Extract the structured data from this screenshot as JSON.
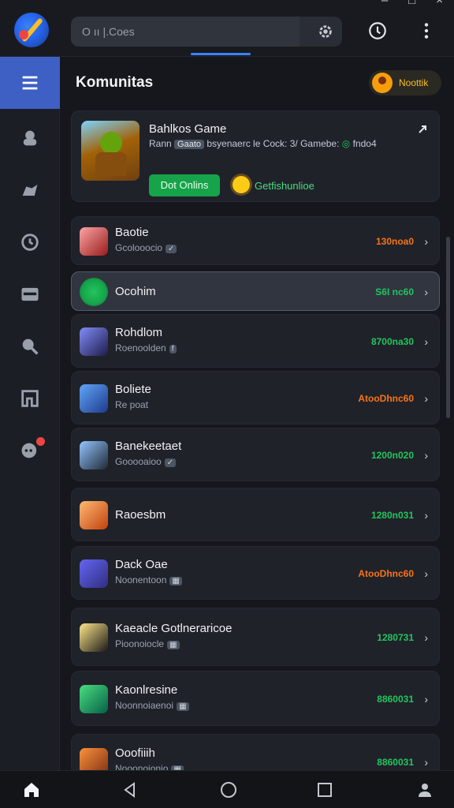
{
  "search": {
    "placeholder": "O ıı |.Coes"
  },
  "header": {
    "title": "Komunitas",
    "notification_label": "Noottik"
  },
  "featured": {
    "title": "Bahlkos Game",
    "desc_prefix": "Rann",
    "desc_tag": "Gaato",
    "desc_main": "bsyenaerc le Cock: 3/ Gamebe:",
    "desc_green": "◎",
    "desc_suffix": "fndo4",
    "online_button": "Dot Onlins",
    "status_label": "Getfishunlioe"
  },
  "communities": [
    {
      "name": "Baotie",
      "sub": "Gcolooocio",
      "tag": "✓",
      "count": "130noa0",
      "count_color": "#f97316"
    },
    {
      "name": "Ocohim",
      "sub": "",
      "tag": "",
      "count": "S6I nc60",
      "count_color": "#22c55e"
    },
    {
      "name": "Rohdlom",
      "sub": "Roenoolden",
      "tag": "f",
      "count": "8700na30",
      "count_color": "#22c55e"
    },
    {
      "name": "Boliete",
      "sub": "Re poat",
      "tag": "",
      "count": "AtooDhnc60",
      "count_color": "#f97316"
    },
    {
      "name": "Banekeetaet",
      "sub": "Gooooaioo",
      "tag": "✓",
      "count": "1200n020",
      "count_color": "#22c55e"
    },
    {
      "name": "Raoesbm",
      "sub": "",
      "tag": "",
      "count": "1280n031",
      "count_color": "#22c55e"
    },
    {
      "name": "Dack Oae",
      "sub": "Noonentoon",
      "tag": "▦",
      "count": "AtooDhnc60",
      "count_color": "#f97316"
    },
    {
      "name": "Kaeacle Gotlneraricoe",
      "sub": "Pioonoiocle",
      "tag": "▦",
      "count": "1280731",
      "count_color": "#22c55e"
    },
    {
      "name": "Kaonlresine",
      "sub": "Noonnoiaenoi",
      "tag": "▦",
      "count": "8860031",
      "count_color": "#22c55e"
    },
    {
      "name": "Ooofiiih",
      "sub": "Nooonoionio",
      "tag": "▦",
      "count": "8860031",
      "count_color": "#22c55e"
    }
  ],
  "colors": {
    "accent": "#3e5fc4",
    "online_green": "#16a34a",
    "orange": "#f97316"
  },
  "icons": {
    "sidebar": [
      "menu-icon",
      "community-icon",
      "game-icon",
      "history-icon",
      "store-icon",
      "search-icon",
      "library-icon",
      "chat-icon"
    ],
    "bottom_nav": [
      "home-icon",
      "back-icon",
      "circle-home-icon",
      "recents-icon",
      "profile-icon"
    ]
  }
}
